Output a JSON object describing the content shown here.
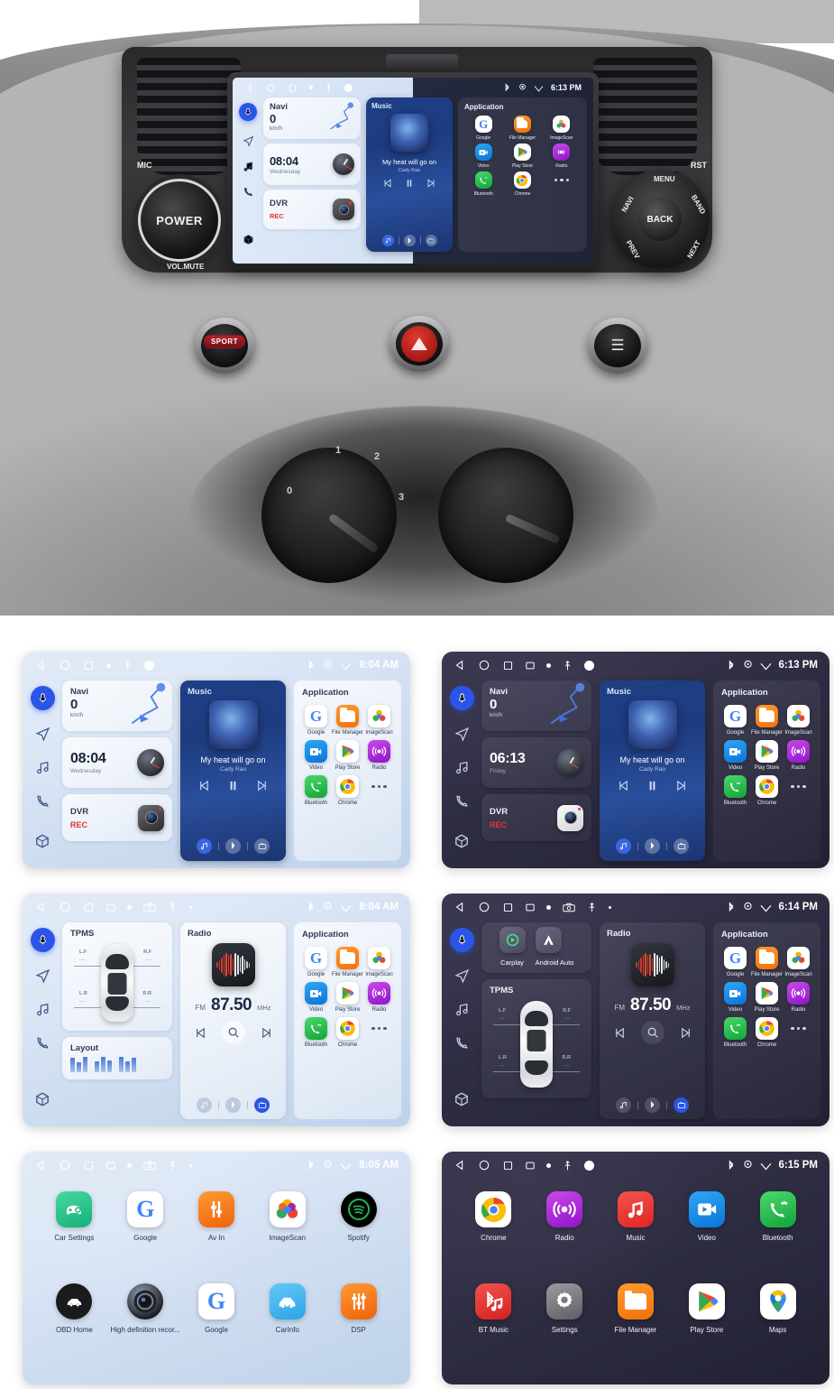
{
  "product": {
    "name": "Car Android Head Unit",
    "hardware": {
      "power_knob_label": "POWER",
      "mic_label": "MIC",
      "vol_mute_label": "VOL.MUTE",
      "rst_label": "RST",
      "dpad": {
        "center": "BACK",
        "top": "MENU",
        "left": "NAVI",
        "right": "BAND",
        "bottom_left": "PREV",
        "bottom_right": "NEXT"
      },
      "buttons": [
        {
          "name": "sport-button",
          "label": "SPORT"
        },
        {
          "name": "hazard-button",
          "label": ""
        },
        {
          "name": "rear-defog-button",
          "label": ""
        }
      ],
      "hvac_ticks": [
        "0",
        "1",
        "2",
        "3"
      ]
    }
  },
  "sidebar": {
    "items": [
      {
        "name": "voice-assistant",
        "icon": "microphone-icon",
        "active": true
      },
      {
        "name": "navigation",
        "icon": "navigation-arrow-icon",
        "active": false
      },
      {
        "name": "music",
        "icon": "music-note-icon",
        "active": false
      },
      {
        "name": "phone",
        "icon": "phone-icon",
        "active": false
      },
      {
        "name": "apps",
        "icon": "apps-cube-icon",
        "active": false
      }
    ]
  },
  "screens": {
    "hero": {
      "statusbar": {
        "time": "6:13 PM",
        "bluetooth": "bluetooth-icon",
        "gps": "location-icon",
        "wifi": "wifi-icon"
      }
    },
    "home_light": {
      "theme": "light",
      "statusbar": {
        "time": "8:04 AM"
      },
      "navi": {
        "title": "Navi",
        "speed": "0",
        "unit": "km/h"
      },
      "clock": {
        "time": "08:04",
        "day": "Wednesday"
      },
      "dvr": {
        "title": "DVR",
        "status": "REC"
      },
      "music": {
        "title": "Music",
        "song": "My heat will go on",
        "artist": "Cady Rao"
      },
      "application": {
        "title": "Application"
      }
    },
    "home_dark": {
      "theme": "dark",
      "statusbar": {
        "time": "6:13 PM"
      },
      "navi": {
        "title": "Navi",
        "speed": "0",
        "unit": "km/h"
      },
      "clock": {
        "time": "06:13",
        "day": "Friday"
      },
      "dvr": {
        "title": "DVR",
        "status": "REC"
      },
      "music": {
        "title": "Music",
        "song": "My heat will go on",
        "artist": "Cady Rao"
      },
      "application": {
        "title": "Application"
      }
    },
    "radio_light": {
      "theme": "light",
      "statusbar": {
        "time": "8:04 AM"
      },
      "tpms": {
        "title": "TPMS",
        "corners": [
          {
            "label": "L.F",
            "value": "----"
          },
          {
            "label": "R.F",
            "value": "----"
          },
          {
            "label": "L.R",
            "value": "----"
          },
          {
            "label": "R.R",
            "value": "----"
          }
        ]
      },
      "layout": {
        "title": "Layout"
      },
      "radio": {
        "title": "Radio",
        "band": "FM",
        "frequency": "87.50",
        "unit": "MHz"
      },
      "application": {
        "title": "Application"
      }
    },
    "radio_dark": {
      "theme": "dark",
      "statusbar": {
        "time": "6:14 PM"
      },
      "projection": {
        "items": [
          {
            "label": "Carplay",
            "icon": "carplay-icon"
          },
          {
            "label": "Android Auto",
            "icon": "android-auto-icon"
          }
        ]
      },
      "tpms": {
        "title": "TPMS",
        "corners": [
          {
            "label": "L.F",
            "value": "----"
          },
          {
            "label": "R.F",
            "value": "----"
          },
          {
            "label": "L.R",
            "value": "----"
          },
          {
            "label": "R.R",
            "value": "----"
          }
        ]
      },
      "radio": {
        "title": "Radio",
        "band": "FM",
        "frequency": "87.50",
        "unit": "MHz"
      },
      "application": {
        "title": "Application"
      }
    },
    "drawer_light": {
      "theme": "light",
      "statusbar": {
        "time": "8:05 AM"
      },
      "apps": [
        {
          "label": "Car Settings",
          "icon": "car-settings-icon"
        },
        {
          "label": "Google",
          "icon": "google-icon"
        },
        {
          "label": "Av In",
          "icon": "av-in-icon"
        },
        {
          "label": "ImageScan",
          "icon": "imagescan-icon"
        },
        {
          "label": "Spotify",
          "icon": "spotify-icon"
        },
        {
          "label": "OBD Home",
          "icon": "obd-home-icon"
        },
        {
          "label": "High definition recor...",
          "icon": "hd-recorder-icon"
        },
        {
          "label": "Google",
          "icon": "google-icon"
        },
        {
          "label": "CarInfo",
          "icon": "carinfo-icon"
        },
        {
          "label": "DSP",
          "icon": "dsp-icon"
        }
      ]
    },
    "drawer_dark": {
      "theme": "dark",
      "statusbar": {
        "time": "6:15 PM"
      },
      "apps": [
        {
          "label": "Chrome",
          "icon": "chrome-icon"
        },
        {
          "label": "Radio",
          "icon": "radio-icon"
        },
        {
          "label": "Music",
          "icon": "music-icon"
        },
        {
          "label": "Video",
          "icon": "video-icon"
        },
        {
          "label": "Bluetooth",
          "icon": "bluetooth-phone-icon"
        },
        {
          "label": "BT Music",
          "icon": "bt-music-icon"
        },
        {
          "label": "Settings",
          "icon": "settings-gear-icon"
        },
        {
          "label": "File Manager",
          "icon": "folder-icon"
        },
        {
          "label": "Play Store",
          "icon": "play-store-icon"
        },
        {
          "label": "Maps",
          "icon": "maps-icon"
        }
      ]
    }
  },
  "app_shortcuts": [
    {
      "label": "Google",
      "icon": "google-icon"
    },
    {
      "label": "File Manager",
      "icon": "folder-icon"
    },
    {
      "label": "ImageScan",
      "icon": "imagescan-icon"
    },
    {
      "label": "Video",
      "icon": "video-icon"
    },
    {
      "label": "Play Store",
      "icon": "play-store-icon"
    },
    {
      "label": "Radio",
      "icon": "radio-icon"
    },
    {
      "label": "Bluetooth",
      "icon": "bluetooth-phone-icon"
    },
    {
      "label": "Chrome",
      "icon": "chrome-icon"
    },
    {
      "label": "More",
      "icon": "more-dots-icon"
    }
  ],
  "colors": {
    "accent_blue": "#2b55e8",
    "rec_red": "#e2352b",
    "light_bg": "#d3e0f2",
    "dark_bg": "#2e2d42",
    "music_widget": "#1f3f86"
  }
}
